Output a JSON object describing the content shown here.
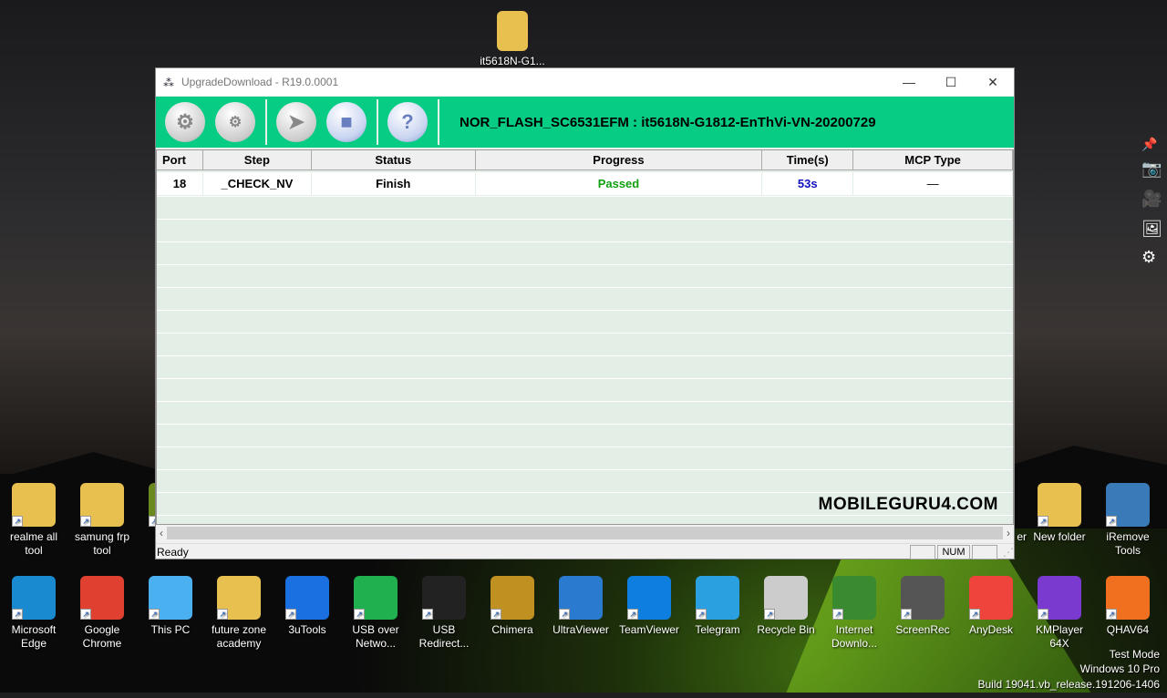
{
  "window": {
    "title": "UpgradeDownload - R19.0.0001",
    "controls": [
      "—",
      "☐",
      "✕"
    ],
    "toolbar": {
      "buttons": [
        {
          "name": "settings",
          "glyph": "⚙"
        },
        {
          "name": "advanced-settings",
          "glyph": "⚙"
        },
        {
          "name": "start",
          "glyph": "➤"
        },
        {
          "name": "stop",
          "glyph": "■"
        },
        {
          "name": "help",
          "glyph": "?"
        }
      ],
      "title": "NOR_FLASH_SC6531EFM : it5618N-G1812-EnThVi-VN-20200729"
    },
    "table": {
      "columns": [
        "Port",
        "Step",
        "Status",
        "Progress",
        "Time(s)",
        "MCP Type"
      ],
      "rows": [
        {
          "port": "18",
          "step": "_CHECK_NV",
          "status": "Finish",
          "progress": "Passed",
          "time": "53s",
          "mcp": "—"
        }
      ]
    },
    "watermark": "MOBILEGURU4.COM",
    "status": {
      "text": "Ready",
      "panes": [
        "",
        "NUM",
        ""
      ]
    },
    "colors": {
      "toolbar": "#07cd84",
      "passed": "#10a010",
      "time": "#1010c0"
    }
  },
  "desktop": {
    "top_icon": "it5618N-G1...",
    "row1": [
      {
        "label": "realme all tool",
        "color": "#e8c050"
      },
      {
        "label": "samung frp tool",
        "color": "#e8c050"
      },
      {
        "label": "",
        "color": "#6a8a20"
      },
      {
        "label": "New folder",
        "color": "#e8c050"
      },
      {
        "label": "iRemove Tools",
        "color": "#3a7ab8"
      }
    ],
    "row2": [
      {
        "label": "Microsoft Edge",
        "color": "#1a8ad0"
      },
      {
        "label": "Google Chrome",
        "color": "#e04030"
      },
      {
        "label": "This PC",
        "color": "#4ab0f0"
      },
      {
        "label": "future zone academy",
        "color": "#e8c050"
      },
      {
        "label": "3uTools",
        "color": "#1a70e0"
      },
      {
        "label": "USB over Netwo...",
        "color": "#20b050"
      },
      {
        "label": "USB Redirect...",
        "color": "#222"
      },
      {
        "label": "Chimera",
        "color": "#c09020"
      },
      {
        "label": "UltraViewer",
        "color": "#2a7ad0"
      },
      {
        "label": "TeamViewer",
        "color": "#0e7ee0"
      },
      {
        "label": "Telegram",
        "color": "#2aa0e0"
      },
      {
        "label": "Recycle Bin",
        "color": "#ccc"
      },
      {
        "label": "Internet Downlo...",
        "color": "#3a8a30"
      },
      {
        "label": "ScreenRec",
        "color": "#555"
      },
      {
        "label": "AnyDesk",
        "color": "#ef443b"
      },
      {
        "label": "KMPlayer 64X",
        "color": "#7a3ad0"
      },
      {
        "label": "QHAV64",
        "color": "#f07020"
      }
    ],
    "partial_label": "er",
    "side_icons": [
      "pin-icon",
      "camera-icon",
      "video-icon",
      "gallery-icon",
      "gear-icon"
    ],
    "watermark_lines": [
      "Test Mode",
      "Windows 10 Pro",
      "Build 19041.vb_release.191206-1406"
    ]
  }
}
